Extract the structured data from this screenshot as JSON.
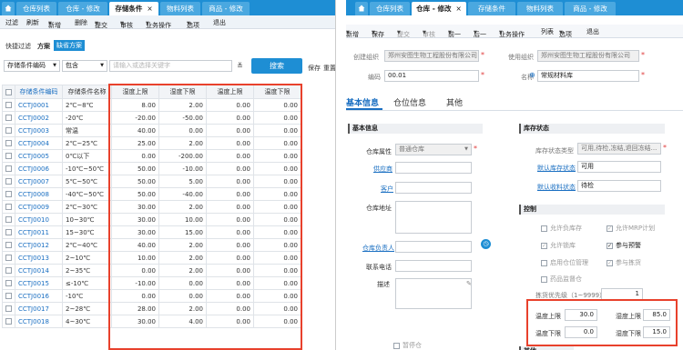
{
  "left": {
    "tabs": [
      {
        "label": "仓库列表"
      },
      {
        "label": "仓库 - 修改"
      },
      {
        "label": "存储条件",
        "close": "×"
      },
      {
        "label": "物料列表"
      },
      {
        "label": "商品 - 修改"
      }
    ],
    "toolbar": [
      "过滤",
      "刷新",
      "新增",
      "删除",
      "提交",
      "审核",
      "业务操作",
      "选项",
      "退出"
    ],
    "filter": {
      "quick": "快捷过滤",
      "plan": "方案",
      "default_plan": "缺省方案",
      "field": "存储条件编码",
      "op": "包含",
      "placeholder": "请输入或选择关键字",
      "search": "搜索",
      "save": "保存",
      "reset": "重置"
    },
    "columns": [
      "存储条件编码",
      "存储条件名称",
      "湿度上限",
      "湿度下限",
      "温度上限",
      "温度下限"
    ],
    "rows": [
      [
        "CCTJ0001",
        "2℃~8℃",
        "8.00",
        "2.00",
        "0.00",
        "0.00"
      ],
      [
        "CCTJ0002",
        "-20℃",
        "-20.00",
        "-50.00",
        "0.00",
        "0.00"
      ],
      [
        "CCTJ0003",
        "常温",
        "40.00",
        "0.00",
        "0.00",
        "0.00"
      ],
      [
        "CCTJ0004",
        "2℃~25℃",
        "25.00",
        "2.00",
        "0.00",
        "0.00"
      ],
      [
        "CCTJ0005",
        "0℃以下",
        "0.00",
        "-200.00",
        "0.00",
        "0.00"
      ],
      [
        "CCTJ0006",
        "-10℃~50℃",
        "50.00",
        "-10.00",
        "0.00",
        "0.00"
      ],
      [
        "CCTJ0007",
        "5℃~50℃",
        "50.00",
        "5.00",
        "0.00",
        "0.00"
      ],
      [
        "CCTJ0008",
        "-40℃~50℃",
        "50.00",
        "-40.00",
        "0.00",
        "0.00"
      ],
      [
        "CCTJ0009",
        "2℃~30℃",
        "30.00",
        "2.00",
        "0.00",
        "0.00"
      ],
      [
        "CCTJ0010",
        "10~30℃",
        "30.00",
        "10.00",
        "0.00",
        "0.00"
      ],
      [
        "CCTJ0011",
        "15~30℃",
        "30.00",
        "15.00",
        "0.00",
        "0.00"
      ],
      [
        "CCTJ0012",
        "2℃~40℃",
        "40.00",
        "2.00",
        "0.00",
        "0.00"
      ],
      [
        "CCTJ0013",
        "2~10℃",
        "10.00",
        "2.00",
        "0.00",
        "0.00"
      ],
      [
        "CCTJ0014",
        "2~35℃",
        "0.00",
        "2.00",
        "0.00",
        "0.00"
      ],
      [
        "CCTJ0015",
        "≤-10℃",
        "-10.00",
        "0.00",
        "0.00",
        "0.00"
      ],
      [
        "CCTJ0016",
        "-10℃",
        "0.00",
        "0.00",
        "0.00",
        "0.00"
      ],
      [
        "CCTJ0017",
        "2~28℃",
        "28.00",
        "2.00",
        "0.00",
        "0.00"
      ],
      [
        "CCTJ0018",
        "4~30℃",
        "30.00",
        "4.00",
        "0.00",
        "0.00"
      ]
    ]
  },
  "right": {
    "tabs": [
      {
        "label": "仓库列表"
      },
      {
        "label": "仓库 - 修改",
        "close": "×"
      },
      {
        "label": "存储条件"
      },
      {
        "label": "物料列表"
      },
      {
        "label": "商品 - 修改"
      }
    ],
    "toolbar": [
      "新增",
      "保存",
      "提交",
      "审核",
      "前一",
      "后一",
      "业务操作",
      "列表",
      "选项",
      "退出"
    ],
    "create_org_label": "创建组织",
    "create_org": "郑州安图生物工程股份有限公司",
    "use_org_label": "使用组织",
    "use_org": "郑州安图生物工程股份有限公司",
    "code_label": "编码",
    "code": "00.01",
    "name_label": "名称",
    "name": "常规材料库",
    "page_tabs": [
      "基本信息",
      "仓位信息",
      "其他"
    ],
    "basic_section": "基本信息",
    "stock_section": "库存状态",
    "control_section": "控制",
    "attr_label": "仓库属性",
    "attr": "普通仓库",
    "supplier_label": "供应商",
    "customer_label": "客户",
    "address_label": "仓库地址",
    "manager_label": "仓库负责人",
    "phone_label": "联系电话",
    "desc_label": "描述",
    "stock_type_label": "库存状态类型",
    "stock_type": "可用,待检,冻结,退回冻结...",
    "default_stock_label": "默认库存状态",
    "default_stock": "可用",
    "default_recv_label": "默认收料状态",
    "default_recv": "待检",
    "checks": [
      {
        "label": "允许负库存",
        "checked": false,
        "enabled": false
      },
      {
        "label": "允许MRP计划",
        "checked": true,
        "enabled": false
      },
      {
        "label": "允许锁库",
        "checked": true,
        "enabled": false
      },
      {
        "label": "参与预警",
        "checked": true,
        "enabled": true
      },
      {
        "label": "启用仓位管理",
        "checked": false,
        "enabled": false
      },
      {
        "label": "参与拣货",
        "checked": true,
        "enabled": false
      },
      {
        "label": "药品监督仓",
        "checked": false,
        "enabled": false
      }
    ],
    "priority_label": "拣货优先级（1~9999）",
    "priority": "1",
    "temp_upper_label": "温度上限",
    "temp_upper": "30.0",
    "temp_lower_label": "温度下限",
    "temp_lower": "0.0",
    "humid_upper_label": "湿度上限",
    "humid_upper": "85.0",
    "humid_lower_label": "湿度下限",
    "humid_lower": "15.0",
    "bottom_check": "暂停仓",
    "bottom_section": "其他"
  }
}
